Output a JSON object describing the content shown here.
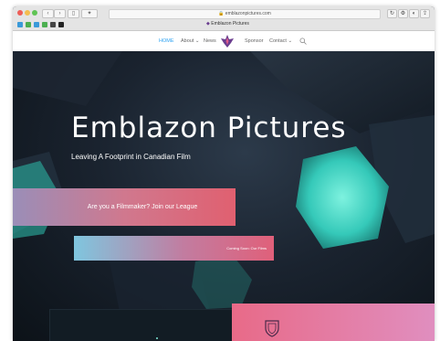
{
  "browser": {
    "url": "emblazonpictures.com",
    "tab_title": "Emblazon Pictures",
    "toolbar_icons": [
      "back-icon",
      "forward-icon",
      "sidebar-icon",
      "reload-icon",
      "share-icon",
      "tabs-icon"
    ]
  },
  "nav": {
    "items": [
      {
        "label": "HOME"
      },
      {
        "label": "About ⌄"
      },
      {
        "label": "News"
      },
      {
        "label": "Sponsor"
      },
      {
        "label": "Contact ⌄"
      }
    ],
    "search_icon": "search-icon",
    "logo": "emblazon-crest-logo"
  },
  "hero": {
    "title": "Emblazon Pictures",
    "subtitle": "Leaving A Footprint in Canadian Film",
    "cta_primary": "Are you a Filmmaker? Join our League",
    "cta_secondary": "Coming Soon: Our Films"
  },
  "colors": {
    "accent_blue": "#2ea3f2",
    "hero_bg": "#1a232f",
    "cta_pink": "#e06070",
    "teal": "#3fd9c5",
    "logo_purple": "#6a3d8f"
  }
}
